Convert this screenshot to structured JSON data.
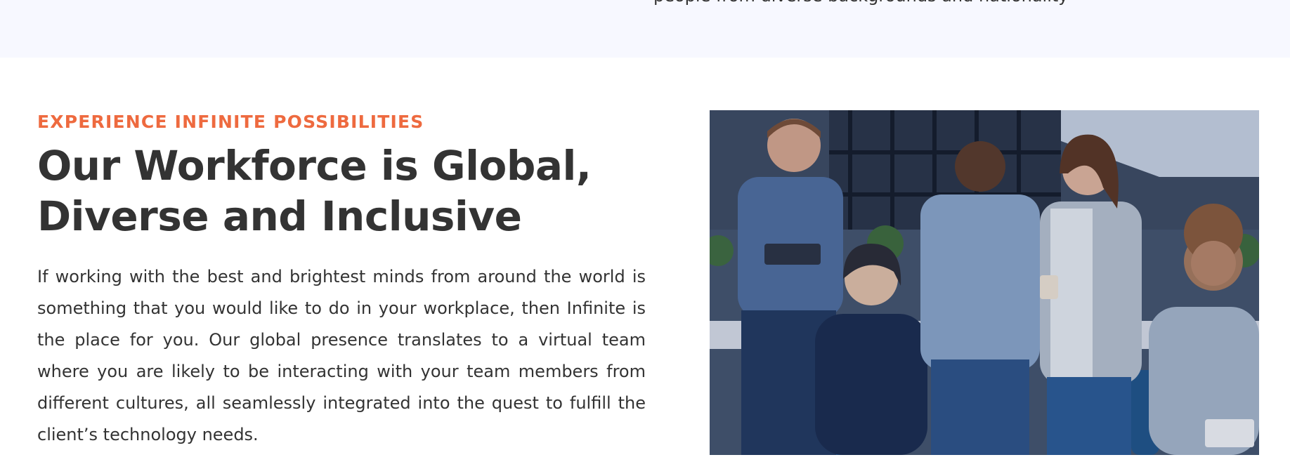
{
  "top_band": {
    "clipped_text": "people from diverse backgrounds and nationality"
  },
  "section": {
    "eyebrow": "EXPERIENCE INFINITE POSSIBILITIES",
    "title_line1": "Our Workforce is Global,",
    "title_line2": "Diverse and Inclusive",
    "body": "If working with the best and brightest minds from around the world is something that you would like to do in your workplace, then Infinite is the place for you. Our global presence translates to a virtual team where you are likely to be interacting with your team members from different cultures, all seamlessly integrated into the quest to fulfill the client’s technology needs."
  },
  "colors": {
    "accent": "#ee6a3f",
    "heading": "#333333",
    "band_bg": "#f7f8ff"
  },
  "image": {
    "subject": "team-photo"
  }
}
